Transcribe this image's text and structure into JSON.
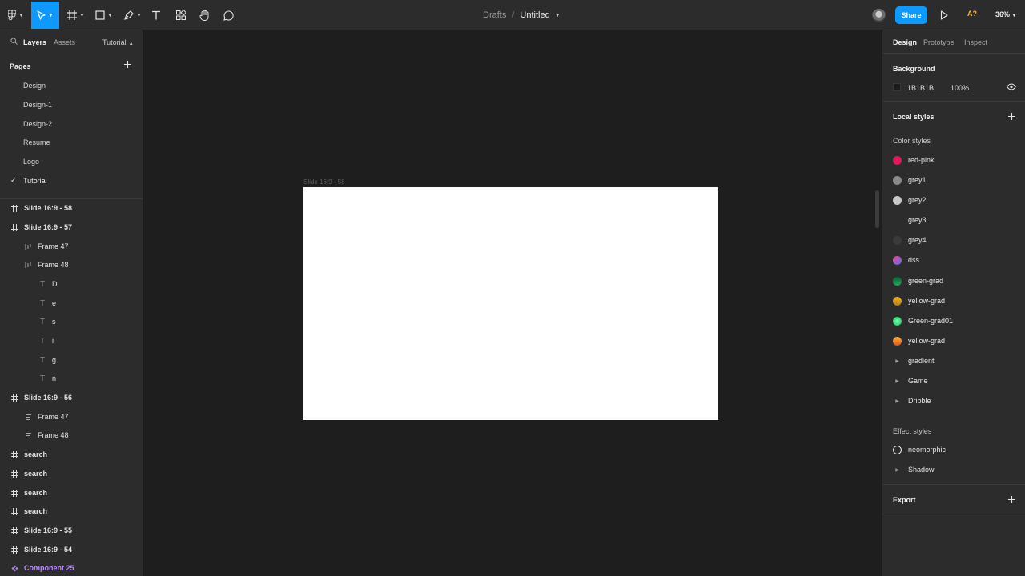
{
  "toolbar": {
    "breadcrumb_parent": "Drafts",
    "separator": "/",
    "file_title": "Untitled",
    "share_label": "Share",
    "assistant_badge": "A?",
    "zoom": "36%",
    "icons": [
      "figma-menu-icon",
      "move-tool-icon",
      "frame-tool-icon",
      "shape-tool-icon",
      "pen-tool-icon",
      "text-tool-icon",
      "resources-icon",
      "hand-tool-icon",
      "comment-tool-icon",
      "present-play-icon"
    ]
  },
  "left_panel": {
    "tabs": {
      "layers": "Layers",
      "assets": "Assets",
      "page_selector": "Tutorial"
    },
    "pages_heading": "Pages",
    "pages": [
      {
        "label": "Design"
      },
      {
        "label": "Design-1"
      },
      {
        "label": "Design-2"
      },
      {
        "label": "Resume"
      },
      {
        "label": "Logo"
      },
      {
        "label": "Tutorial",
        "current": true
      }
    ],
    "layers": [
      {
        "label": "Slide 16:9 - 58",
        "icon": "frame-icon"
      },
      {
        "label": "Slide 16:9 - 57",
        "icon": "frame-icon"
      },
      {
        "label": "Frame 47",
        "icon": "autolayout-horizontal-icon"
      },
      {
        "label": "Frame 48",
        "icon": "autolayout-horizontal-icon"
      },
      {
        "label": "D",
        "icon": "text-layer-icon"
      },
      {
        "label": "e",
        "icon": "text-layer-icon"
      },
      {
        "label": "s",
        "icon": "text-layer-icon"
      },
      {
        "label": "i",
        "icon": "text-layer-icon"
      },
      {
        "label": "g",
        "icon": "text-layer-icon"
      },
      {
        "label": "n",
        "icon": "text-layer-icon"
      },
      {
        "label": "Slide 16:9 - 56",
        "icon": "frame-icon"
      },
      {
        "label": "Frame 47",
        "icon": "autolayout-vertical-icon"
      },
      {
        "label": "Frame 48",
        "icon": "autolayout-vertical-icon"
      },
      {
        "label": "search",
        "icon": "frame-icon"
      },
      {
        "label": "search",
        "icon": "frame-icon"
      },
      {
        "label": "search",
        "icon": "frame-icon"
      },
      {
        "label": "search",
        "icon": "frame-icon"
      },
      {
        "label": "Slide 16:9 - 55",
        "icon": "frame-icon"
      },
      {
        "label": "Slide 16:9 - 54",
        "icon": "frame-icon"
      },
      {
        "label": "Component 25",
        "icon": "component-icon"
      }
    ]
  },
  "canvas": {
    "frame_label": "Slide 16:9 - 58",
    "frame_fill": "#FFFFFF",
    "background": "#1E1E1E"
  },
  "right_panel": {
    "tabs": {
      "design": "Design",
      "prototype": "Prototype",
      "inspect": "Inspect"
    },
    "background": {
      "heading": "Background",
      "hex": "1B1B1B",
      "opacity": "100%"
    },
    "local_styles": {
      "heading": "Local styles",
      "color_styles_heading": "Color styles",
      "color_styles": [
        {
          "name": "red-pink",
          "color": "#E0195A"
        },
        {
          "name": "grey1",
          "color": "#8A8A8A"
        },
        {
          "name": "grey2",
          "color": "#C8C8C8"
        },
        {
          "name": "grey3",
          "color": "#2C2C2C"
        },
        {
          "name": "grey4",
          "color": "#3A3A3A"
        },
        {
          "name": "dss",
          "color": "#7A5CF0"
        },
        {
          "name": "green-grad",
          "color": "#1F8A4C"
        },
        {
          "name": "yellow-grad",
          "color": "#E0A21E"
        },
        {
          "name": "Green-grad01",
          "color": "#22D36A"
        },
        {
          "name": "yellow-grad",
          "color": "#F08A1E"
        }
      ],
      "color_groups": [
        "gradient",
        "Game",
        "Dribble"
      ],
      "effect_styles_heading": "Effect styles",
      "effect_styles": [
        {
          "name": "neomorphic"
        }
      ],
      "effect_groups": [
        "Shadow"
      ]
    },
    "export_heading": "Export"
  }
}
